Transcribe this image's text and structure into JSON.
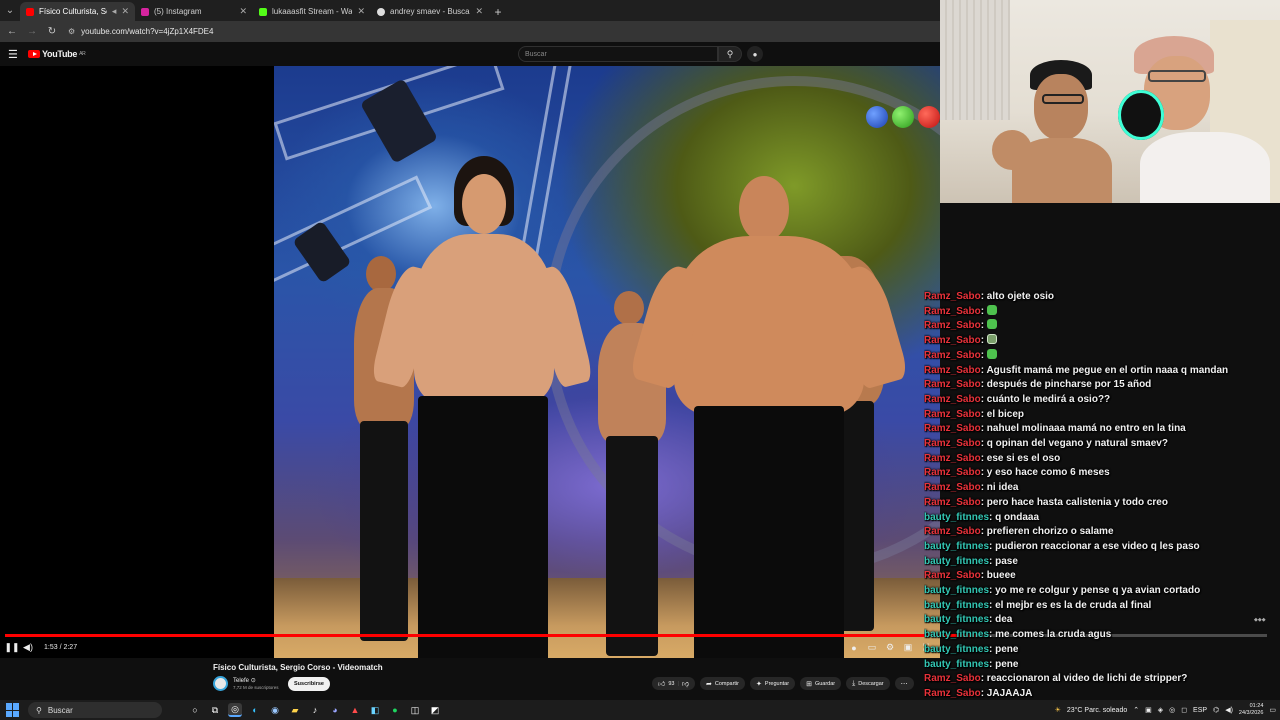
{
  "browser": {
    "tabs": [
      {
        "title": "Físico Culturista,  Sergio Co",
        "color": "#ff0000",
        "active": true
      },
      {
        "title": "(5) Instagram",
        "color": "#d6249f",
        "active": false
      },
      {
        "title": "lukaaasfit Stream - Watch Live",
        "color": "#53fc18",
        "active": false
      },
      {
        "title": "andrey smaev - Buscar con Go",
        "color": "#dddddd",
        "active": false
      }
    ],
    "url": "youtube.com/watch?v=4jZp1X4FDE4"
  },
  "youtube": {
    "logo_text": "YouTube",
    "logo_region": "AR",
    "search_placeholder": "Buscar"
  },
  "player": {
    "time": "1:53 / 2:27",
    "progress_fraction": 0.77
  },
  "video_info": {
    "title": "Físico Culturista,  Sergio Corso - Videomatch",
    "channel": "Telefe",
    "channel_badge": "⊙",
    "subscribers": "7,72 M de suscriptores",
    "subscribe_label": "Suscribirse",
    "likes": "93",
    "share_label": "Compartir",
    "ask_label": "Preguntar",
    "save_label": "Guardar",
    "download_label": "Descargar"
  },
  "chat": [
    {
      "user": "Ramz_Sabo",
      "type": "rz",
      "text": "alto ojete osio"
    },
    {
      "user": "Ramz_Sabo",
      "type": "rz",
      "emote": "green"
    },
    {
      "user": "Ramz_Sabo",
      "type": "rz",
      "emote": "green"
    },
    {
      "user": "Ramz_Sabo",
      "type": "rz",
      "emote": "img"
    },
    {
      "user": "Ramz_Sabo",
      "type": "rz",
      "emote": "green"
    },
    {
      "user": "Ramz_Sabo",
      "type": "rz",
      "text": "Agusfit mamá me pegue en el ortin naaa q mandan"
    },
    {
      "user": "Ramz_Sabo",
      "type": "rz",
      "text": "después de pincharse por 15 añod"
    },
    {
      "user": "Ramz_Sabo",
      "type": "rz",
      "text": "cuánto le medirá a osio??"
    },
    {
      "user": "Ramz_Sabo",
      "type": "rz",
      "text": "el bicep"
    },
    {
      "user": "Ramz_Sabo",
      "type": "rz",
      "text": "nahuel molinaaa mamá no entro en la tina"
    },
    {
      "user": "Ramz_Sabo",
      "type": "rz",
      "text": "q opinan del vegano y natural smaev?"
    },
    {
      "user": "Ramz_Sabo",
      "type": "rz",
      "text": "ese si es el oso"
    },
    {
      "user": "Ramz_Sabo",
      "type": "rz",
      "text": "y eso hace como 6 meses"
    },
    {
      "user": "Ramz_Sabo",
      "type": "rz",
      "text": "ni idea"
    },
    {
      "user": "Ramz_Sabo",
      "type": "rz",
      "text": "pero hace hasta calistenia y todo creo"
    },
    {
      "user": "bauty_fitnnes",
      "type": "bt",
      "text": "q ondaaa"
    },
    {
      "user": "Ramz_Sabo",
      "type": "rz",
      "text": "prefieren chorizo o salame"
    },
    {
      "user": "bauty_fitnnes",
      "type": "bt",
      "text": "pudieron reaccionar a ese video q les paso"
    },
    {
      "user": "bauty_fitnnes",
      "type": "bt",
      "text": "pase"
    },
    {
      "user": "Ramz_Sabo",
      "type": "rz",
      "text": "bueee"
    },
    {
      "user": "bauty_fitnnes",
      "type": "bt",
      "text": "yo me re colgur y pense q ya avian cortado"
    },
    {
      "user": "bauty_fitnnes",
      "type": "bt",
      "text": "el mejbr es es la de cruda al final"
    },
    {
      "user": "bauty_fitnnes",
      "type": "bt",
      "text": "dea"
    },
    {
      "user": "bauty_fitnnes",
      "type": "bt",
      "text": "me comes la cruda agus"
    },
    {
      "user": "bauty_fitnnes",
      "type": "bt",
      "text": "pene"
    },
    {
      "user": "bauty_fitnnes",
      "type": "bt",
      "text": "pene"
    },
    {
      "user": "Ramz_Sabo",
      "type": "rz",
      "text": "reaccionaron al video de lichi de stripper?"
    },
    {
      "user": "Ramz_Sabo",
      "type": "rz",
      "text": "JAJAAJA"
    }
  ],
  "taskbar": {
    "search_label": "Buscar",
    "weather": "23°C  Parc. soleado",
    "language": "ESP",
    "time": "01:24",
    "date": "24/3/2026"
  },
  "colors": {
    "youtube_red": "#ff0000",
    "chat_user_rz": "#e8323a",
    "chat_user_bt": "#33c7b4"
  }
}
